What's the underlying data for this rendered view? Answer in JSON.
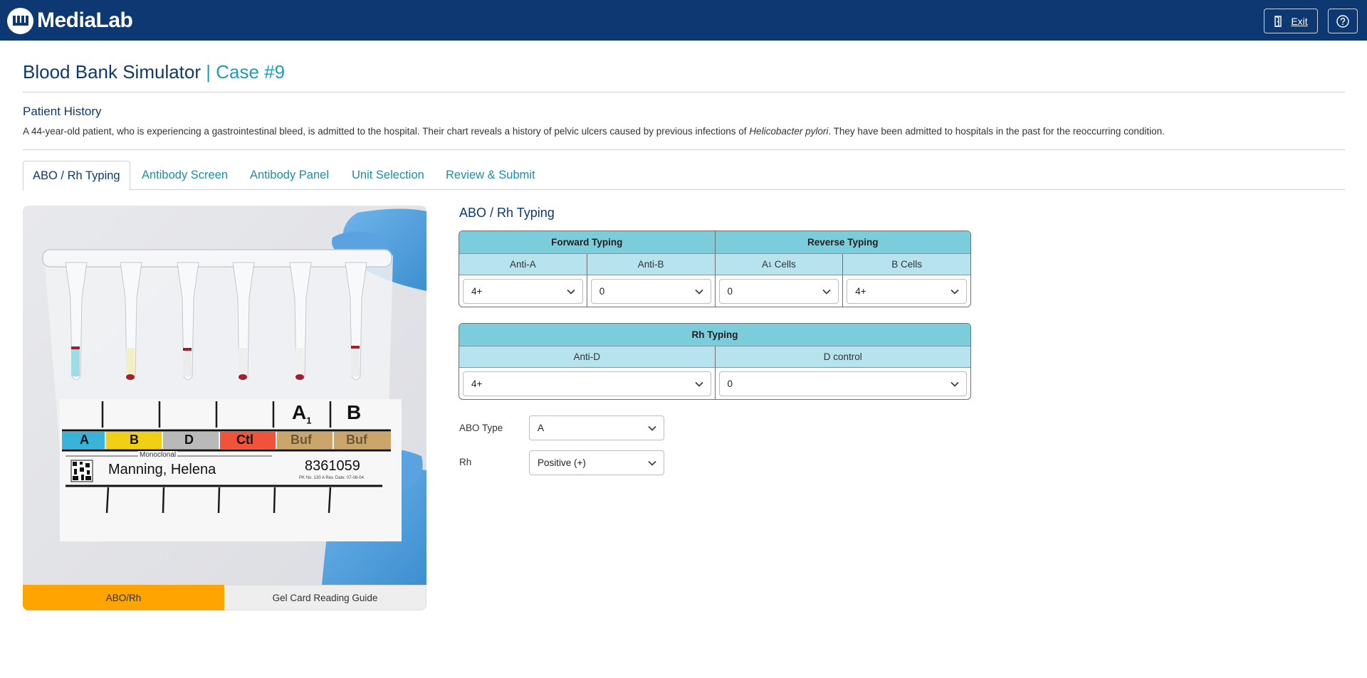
{
  "header": {
    "logo_text": "MediaLab",
    "exit_label": "Exit"
  },
  "page": {
    "title": "Blood Bank Simulator",
    "case_label": "| Case #9"
  },
  "history": {
    "heading": "Patient History",
    "text_before": "A 44-year-old patient, who is experiencing a gastrointestinal bleed, is admitted to the hospital. Their chart reveals a history of pelvic ulcers caused by previous infections of ",
    "organism": "Helicobacter pylori",
    "text_after": ". They have been admitted to hospitals in the past for the reoccurring condition."
  },
  "tabs": [
    "ABO / Rh Typing",
    "Antibody Screen",
    "Antibody Panel",
    "Unit Selection",
    "Review & Submit"
  ],
  "gel_card": {
    "columns": [
      "A",
      "B",
      "D",
      "Ctl",
      "Buf",
      "Buf"
    ],
    "header_labels": [
      "A",
      "1",
      "B"
    ],
    "monoclonal_label": "Monoclonal",
    "patient_name": "Manning, Helena",
    "patient_id": "8361059",
    "fine_print": "PK No. 130 A   Rev. Date: 07-08-04"
  },
  "image_tabs": [
    "ABO/Rh",
    "Gel Card Reading Guide"
  ],
  "abo_rh": {
    "section_title": "ABO / Rh Typing",
    "forward_title": "Forward Typing",
    "reverse_title": "Reverse Typing",
    "col_anti_a": "Anti-A",
    "col_anti_b": "Anti-B",
    "col_a1_main": "A",
    "col_a1_sub": "1",
    "col_a1_tail": " Cells",
    "col_b_cells": "B Cells",
    "val_anti_a": "4+",
    "val_anti_b": "0",
    "val_a1_cells": "0",
    "val_b_cells": "4+",
    "rh_title": "Rh Typing",
    "col_anti_d": "Anti-D",
    "col_d_control": "D control",
    "val_anti_d": "4+",
    "val_d_control": "0"
  },
  "interpretation": {
    "abo_label": "ABO Type",
    "abo_value": "A",
    "rh_label": "Rh",
    "rh_value": "Positive (+)"
  },
  "colors": {
    "topbar": "#0e3872",
    "accent": "#1d9db5",
    "header_cell": "#7ccddb",
    "subheader_cell": "#b6e3ee",
    "active_image_tab": "#ffa400"
  }
}
